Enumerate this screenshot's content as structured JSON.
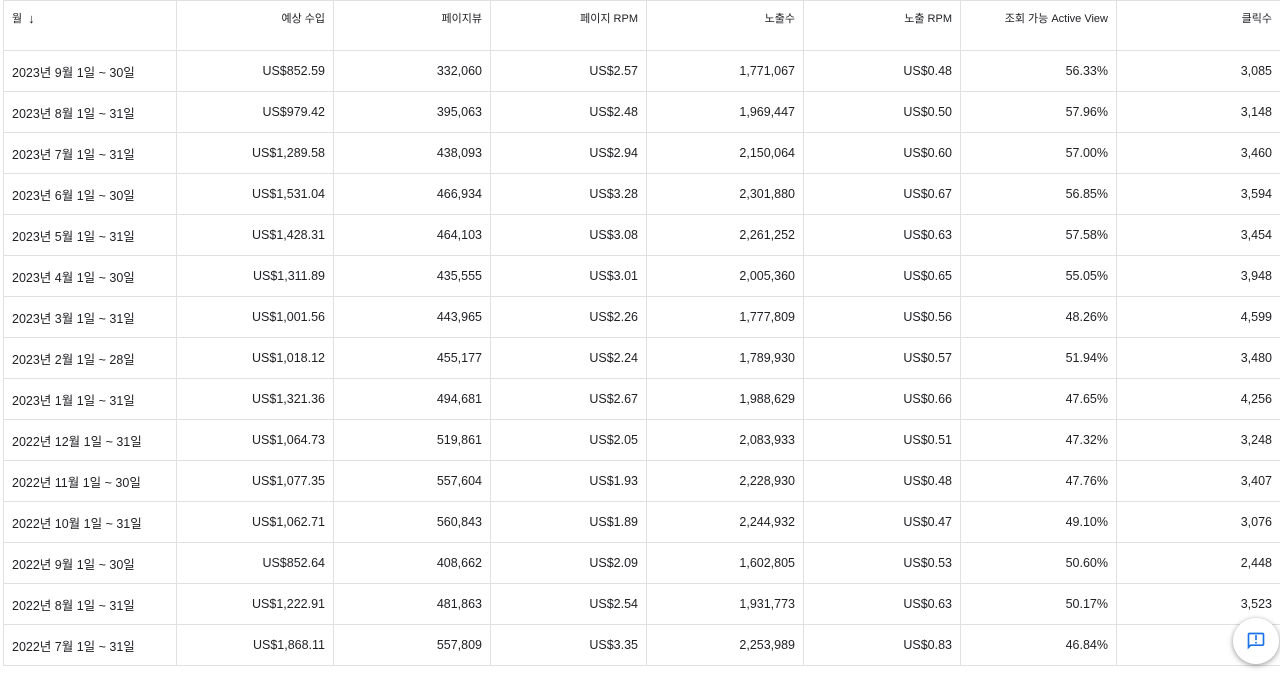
{
  "table": {
    "headers": [
      "월",
      "예상 수입",
      "페이지뷰",
      "페이지 RPM",
      "노출수",
      "노출 RPM",
      "조회 가능 Active View",
      "클릭수"
    ],
    "sort_icon": "arrow-down-icon",
    "rows": [
      [
        "2023년 9월 1일 ~ 30일",
        "US$852.59",
        "332,060",
        "US$2.57",
        "1,771,067",
        "US$0.48",
        "56.33%",
        "3,085"
      ],
      [
        "2023년 8월 1일 ~ 31일",
        "US$979.42",
        "395,063",
        "US$2.48",
        "1,969,447",
        "US$0.50",
        "57.96%",
        "3,148"
      ],
      [
        "2023년 7월 1일 ~ 31일",
        "US$1,289.58",
        "438,093",
        "US$2.94",
        "2,150,064",
        "US$0.60",
        "57.00%",
        "3,460"
      ],
      [
        "2023년 6월 1일 ~ 30일",
        "US$1,531.04",
        "466,934",
        "US$3.28",
        "2,301,880",
        "US$0.67",
        "56.85%",
        "3,594"
      ],
      [
        "2023년 5월 1일 ~ 31일",
        "US$1,428.31",
        "464,103",
        "US$3.08",
        "2,261,252",
        "US$0.63",
        "57.58%",
        "3,454"
      ],
      [
        "2023년 4월 1일 ~ 30일",
        "US$1,311.89",
        "435,555",
        "US$3.01",
        "2,005,360",
        "US$0.65",
        "55.05%",
        "3,948"
      ],
      [
        "2023년 3월 1일 ~ 31일",
        "US$1,001.56",
        "443,965",
        "US$2.26",
        "1,777,809",
        "US$0.56",
        "48.26%",
        "4,599"
      ],
      [
        "2023년 2월 1일 ~ 28일",
        "US$1,018.12",
        "455,177",
        "US$2.24",
        "1,789,930",
        "US$0.57",
        "51.94%",
        "3,480"
      ],
      [
        "2023년 1월 1일 ~ 31일",
        "US$1,321.36",
        "494,681",
        "US$2.67",
        "1,988,629",
        "US$0.66",
        "47.65%",
        "4,256"
      ],
      [
        "2022년 12월 1일 ~ 31일",
        "US$1,064.73",
        "519,861",
        "US$2.05",
        "2,083,933",
        "US$0.51",
        "47.32%",
        "3,248"
      ],
      [
        "2022년 11월 1일 ~ 30일",
        "US$1,077.35",
        "557,604",
        "US$1.93",
        "2,228,930",
        "US$0.48",
        "47.76%",
        "3,407"
      ],
      [
        "2022년 10월 1일 ~ 31일",
        "US$1,062.71",
        "560,843",
        "US$1.89",
        "2,244,932",
        "US$0.47",
        "49.10%",
        "3,076"
      ],
      [
        "2022년 9월 1일 ~ 30일",
        "US$852.64",
        "408,662",
        "US$2.09",
        "1,602,805",
        "US$0.53",
        "50.60%",
        "2,448"
      ],
      [
        "2022년 8월 1일 ~ 31일",
        "US$1,222.91",
        "481,863",
        "US$2.54",
        "1,931,773",
        "US$0.63",
        "50.17%",
        "3,523"
      ],
      [
        "2022년 7월 1일 ~ 31일",
        "US$1,868.11",
        "557,809",
        "US$3.35",
        "2,253,989",
        "US$0.83",
        "46.84%",
        ""
      ]
    ]
  },
  "feedback_button": {
    "icon": "feedback-icon",
    "color": "#1a73e8"
  }
}
